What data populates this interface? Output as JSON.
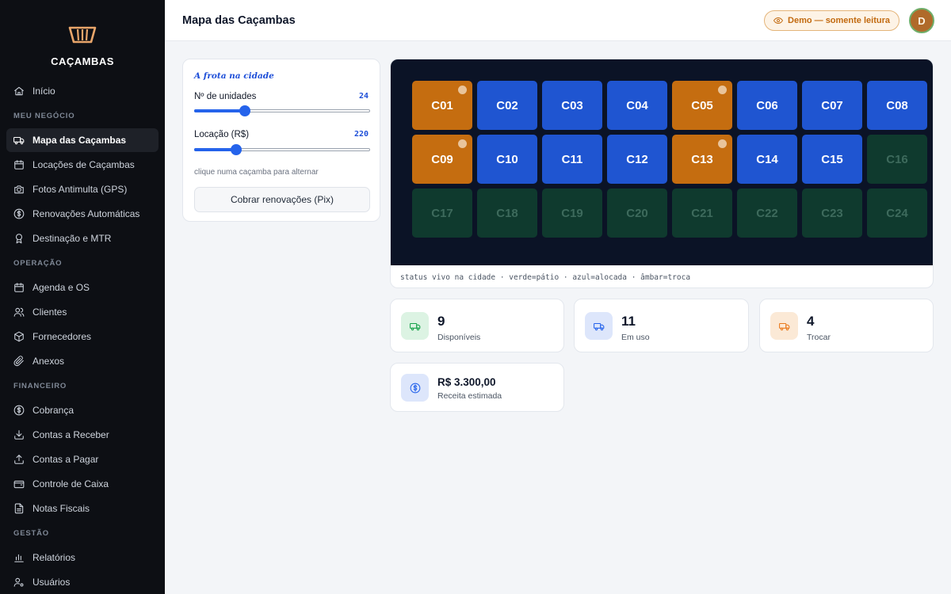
{
  "brand": {
    "name": "CAÇAMBAS"
  },
  "sidebar": {
    "top": [
      {
        "label": "Início",
        "icon": "home-icon"
      }
    ],
    "sections": [
      {
        "title": "MEU NEGÓCIO",
        "items": [
          {
            "label": "Mapa das Caçambas",
            "icon": "truck-icon",
            "active": true
          },
          {
            "label": "Locações de Caçambas",
            "icon": "calendar-icon"
          },
          {
            "label": "Fotos Antimulta (GPS)",
            "icon": "camera-icon"
          },
          {
            "label": "Renovações Automáticas",
            "icon": "dollar-circle-icon"
          },
          {
            "label": "Destinação e MTR",
            "icon": "award-icon"
          }
        ]
      },
      {
        "title": "OPERAÇÃO",
        "items": [
          {
            "label": "Agenda e OS",
            "icon": "calendar-icon"
          },
          {
            "label": "Clientes",
            "icon": "users-icon"
          },
          {
            "label": "Fornecedores",
            "icon": "box-icon"
          },
          {
            "label": "Anexos",
            "icon": "paperclip-icon"
          }
        ]
      },
      {
        "title": "FINANCEIRO",
        "items": [
          {
            "label": "Cobrança",
            "icon": "dollar-circle-icon"
          },
          {
            "label": "Contas a Receber",
            "icon": "download-icon"
          },
          {
            "label": "Contas a Pagar",
            "icon": "upload-icon"
          },
          {
            "label": "Controle de Caixa",
            "icon": "wallet-icon"
          },
          {
            "label": "Notas Fiscais",
            "icon": "file-icon"
          }
        ]
      },
      {
        "title": "GESTÃO",
        "items": [
          {
            "label": "Relatórios",
            "icon": "bar-chart-icon"
          },
          {
            "label": "Usuários",
            "icon": "user-cog-icon"
          }
        ]
      }
    ]
  },
  "header": {
    "title": "Mapa das Caçambas",
    "demo_badge": "Demo — somente leitura",
    "avatar_initial": "D"
  },
  "controls": {
    "title": "A frota na cidade",
    "units": {
      "label": "Nº de unidades",
      "value": "24",
      "fraction": 0.29
    },
    "rent": {
      "label": "Locação (R$)",
      "value": "220",
      "fraction": 0.24
    },
    "hint": "clique numa caçamba para alternar",
    "button": "Cobrar renovações (Pix)"
  },
  "map": {
    "caption": "status vivo na cidade · verde=pátio · azul=alocada · âmbar=troca",
    "colors": {
      "verde": "#0f3a2e",
      "azul": "#1f55d1",
      "ambar": "#c56d10"
    },
    "cells": [
      {
        "id": "C01",
        "status": "ambar"
      },
      {
        "id": "C02",
        "status": "azul"
      },
      {
        "id": "C03",
        "status": "azul"
      },
      {
        "id": "C04",
        "status": "azul"
      },
      {
        "id": "C05",
        "status": "ambar"
      },
      {
        "id": "C06",
        "status": "azul"
      },
      {
        "id": "C07",
        "status": "azul"
      },
      {
        "id": "C08",
        "status": "azul"
      },
      {
        "id": "C09",
        "status": "ambar"
      },
      {
        "id": "C10",
        "status": "azul"
      },
      {
        "id": "C11",
        "status": "azul"
      },
      {
        "id": "C12",
        "status": "azul"
      },
      {
        "id": "C13",
        "status": "ambar"
      },
      {
        "id": "C14",
        "status": "azul"
      },
      {
        "id": "C15",
        "status": "azul"
      },
      {
        "id": "C16",
        "status": "verde"
      },
      {
        "id": "C17",
        "status": "verde"
      },
      {
        "id": "C18",
        "status": "verde"
      },
      {
        "id": "C19",
        "status": "verde"
      },
      {
        "id": "C20",
        "status": "verde"
      },
      {
        "id": "C21",
        "status": "verde"
      },
      {
        "id": "C22",
        "status": "verde"
      },
      {
        "id": "C23",
        "status": "verde"
      },
      {
        "id": "C24",
        "status": "verde"
      }
    ]
  },
  "stats": {
    "available": {
      "value": "9",
      "label": "Disponíveis",
      "color": "#16a34a"
    },
    "in_use": {
      "value": "11",
      "label": "Em uso",
      "color": "#2563eb"
    },
    "swap": {
      "value": "4",
      "label": "Trocar",
      "color": "#ea7a1c"
    },
    "revenue": {
      "value": "R$ 3.300,00",
      "label": "Receita estimada",
      "color": "#2563eb"
    }
  }
}
